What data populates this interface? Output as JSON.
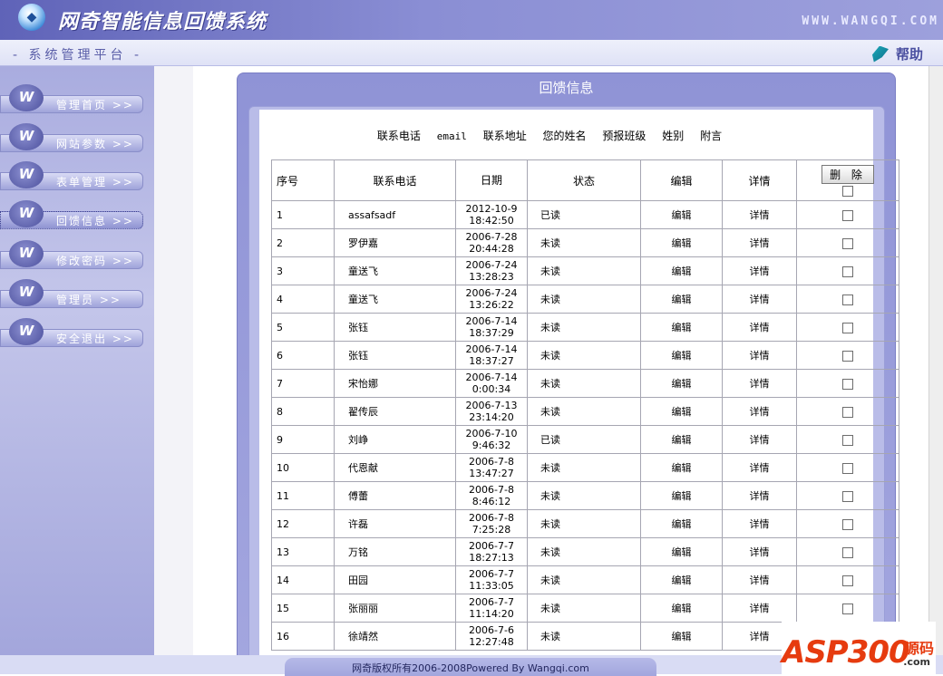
{
  "app": {
    "title": "网奇智能信息回馈系统",
    "site_url": "WWW.WANGQI.COM",
    "platform_title": "- 系统管理平台 -",
    "help_label": "帮助"
  },
  "sidebar": {
    "items": [
      {
        "label": "管理首页 >>"
      },
      {
        "label": "网站参数 >>"
      },
      {
        "label": "表单管理 >>"
      },
      {
        "label": "回馈信息 >>"
      },
      {
        "label": "修改密码 >>"
      },
      {
        "label": "管理员 >>"
      },
      {
        "label": "安全退出 >>"
      }
    ]
  },
  "panel": {
    "title": "回馈信息",
    "fields": [
      "联系电话",
      "email",
      "联系地址",
      "您的姓名",
      "预报班级",
      "姓别",
      "附言"
    ]
  },
  "table": {
    "headers": {
      "no": "序号",
      "phone": "联系电话",
      "date": "日期",
      "status": "状态",
      "edit": "编辑",
      "detail": "详情"
    },
    "delete_label": "删 除",
    "rows": [
      {
        "no": "1",
        "phone": "assafsadf",
        "date1": "2012-10-9",
        "date2": "18:42:50",
        "status": "已读",
        "edit": "编辑",
        "detail": "详情"
      },
      {
        "no": "2",
        "phone": "罗伊嘉",
        "date1": "2006-7-28",
        "date2": "20:44:28",
        "status": "未读",
        "edit": "编辑",
        "detail": "详情"
      },
      {
        "no": "3",
        "phone": "童送飞",
        "date1": "2006-7-24",
        "date2": "13:28:23",
        "status": "未读",
        "edit": "编辑",
        "detail": "详情"
      },
      {
        "no": "4",
        "phone": "童送飞",
        "date1": "2006-7-24",
        "date2": "13:26:22",
        "status": "未读",
        "edit": "编辑",
        "detail": "详情"
      },
      {
        "no": "5",
        "phone": "张钰",
        "date1": "2006-7-14",
        "date2": "18:37:29",
        "status": "未读",
        "edit": "编辑",
        "detail": "详情"
      },
      {
        "no": "6",
        "phone": "张钰",
        "date1": "2006-7-14",
        "date2": "18:37:27",
        "status": "未读",
        "edit": "编辑",
        "detail": "详情"
      },
      {
        "no": "7",
        "phone": "宋怡娜",
        "date1": "2006-7-14",
        "date2": "0:00:34",
        "status": "未读",
        "edit": "编辑",
        "detail": "详情"
      },
      {
        "no": "8",
        "phone": "翟传辰",
        "date1": "2006-7-13",
        "date2": "23:14:20",
        "status": "未读",
        "edit": "编辑",
        "detail": "详情"
      },
      {
        "no": "9",
        "phone": "刘峥",
        "date1": "2006-7-10",
        "date2": "9:46:32",
        "status": "已读",
        "edit": "编辑",
        "detail": "详情"
      },
      {
        "no": "10",
        "phone": "代恩献",
        "date1": "2006-7-8",
        "date2": "13:47:27",
        "status": "未读",
        "edit": "编辑",
        "detail": "详情"
      },
      {
        "no": "11",
        "phone": "傅蕾",
        "date1": "2006-7-8",
        "date2": "8:46:12",
        "status": "未读",
        "edit": "编辑",
        "detail": "详情"
      },
      {
        "no": "12",
        "phone": "许磊",
        "date1": "2006-7-8",
        "date2": "7:25:28",
        "status": "未读",
        "edit": "编辑",
        "detail": "详情"
      },
      {
        "no": "13",
        "phone": "万铭",
        "date1": "2006-7-7",
        "date2": "18:27:13",
        "status": "未读",
        "edit": "编辑",
        "detail": "详情"
      },
      {
        "no": "14",
        "phone": "田园",
        "date1": "2006-7-7",
        "date2": "11:33:05",
        "status": "未读",
        "edit": "编辑",
        "detail": "详情"
      },
      {
        "no": "15",
        "phone": "张丽丽",
        "date1": "2006-7-7",
        "date2": "11:14:20",
        "status": "未读",
        "edit": "编辑",
        "detail": "详情"
      },
      {
        "no": "16",
        "phone": "徐靖然",
        "date1": "2006-7-6",
        "date2": "12:27:48",
        "status": "未读",
        "edit": "编辑",
        "detail": "详情"
      }
    ]
  },
  "footer": {
    "copyright": "网奇版权所有2006-2008Powered By Wangqi.com"
  },
  "watermark": {
    "logo_text": "ASP300",
    "cn_text": "源码",
    "com_text": ".com"
  }
}
